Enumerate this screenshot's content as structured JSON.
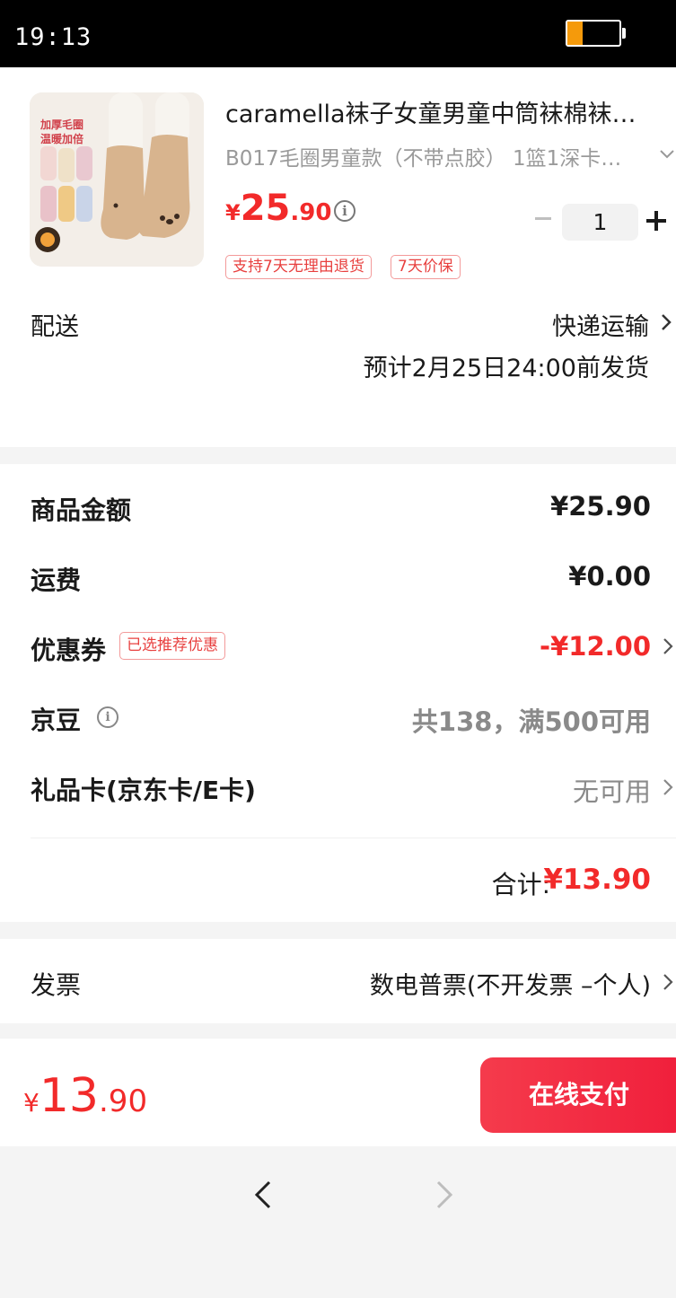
{
  "status_bar": {
    "time": "19:13",
    "battery_level": 0.3,
    "battery_color": "#f59a0b"
  },
  "product": {
    "title": "caramella袜子女童男童中筒袜棉袜…",
    "spec": "B017毛圈男童款（不带点胶） 1篮1深卡…",
    "image_text_line1": "加厚毛圈",
    "image_text_line2": "温暖加倍",
    "price_symbol": "¥",
    "price_int": "25",
    "price_dec": ".90",
    "quantity": "1",
    "tags": [
      "支持7天无理由退货",
      "7天价保"
    ]
  },
  "delivery": {
    "label": "配送",
    "method": "快递运输",
    "eta": "预计2月25日24:00前发货"
  },
  "summary": {
    "goods_label": "商品金额",
    "goods_value": "¥25.90",
    "shipping_label": "运费",
    "shipping_value": "¥0.00",
    "coupon_label": "优惠券",
    "coupon_tag": "已选推荐优惠",
    "coupon_value": "-¥12.00",
    "beans_label": "京豆",
    "beans_value": "共138，满500可用",
    "giftcard_label": "礼品卡(京东卡/E卡)",
    "giftcard_value": "无可用",
    "total_label": "合计:",
    "total_value": "¥13.90"
  },
  "invoice": {
    "label": "发票",
    "value": "数电普票(不开发票 –个人)"
  },
  "pay_bar": {
    "price_symbol": "¥",
    "price_int": "13",
    "price_dec": ".90",
    "button_label": "在线支付"
  },
  "colors": {
    "accent_red": "#f22a2a",
    "pay_button": "#f53b4c",
    "tag_border": "#f39a9a",
    "muted_text": "#9a9a9a"
  },
  "icons": [
    "info-icon",
    "chevron-down-icon",
    "chevron-right-icon",
    "minus-icon",
    "plus-icon",
    "back-arrow-icon",
    "forward-arrow-icon",
    "battery-icon"
  ]
}
